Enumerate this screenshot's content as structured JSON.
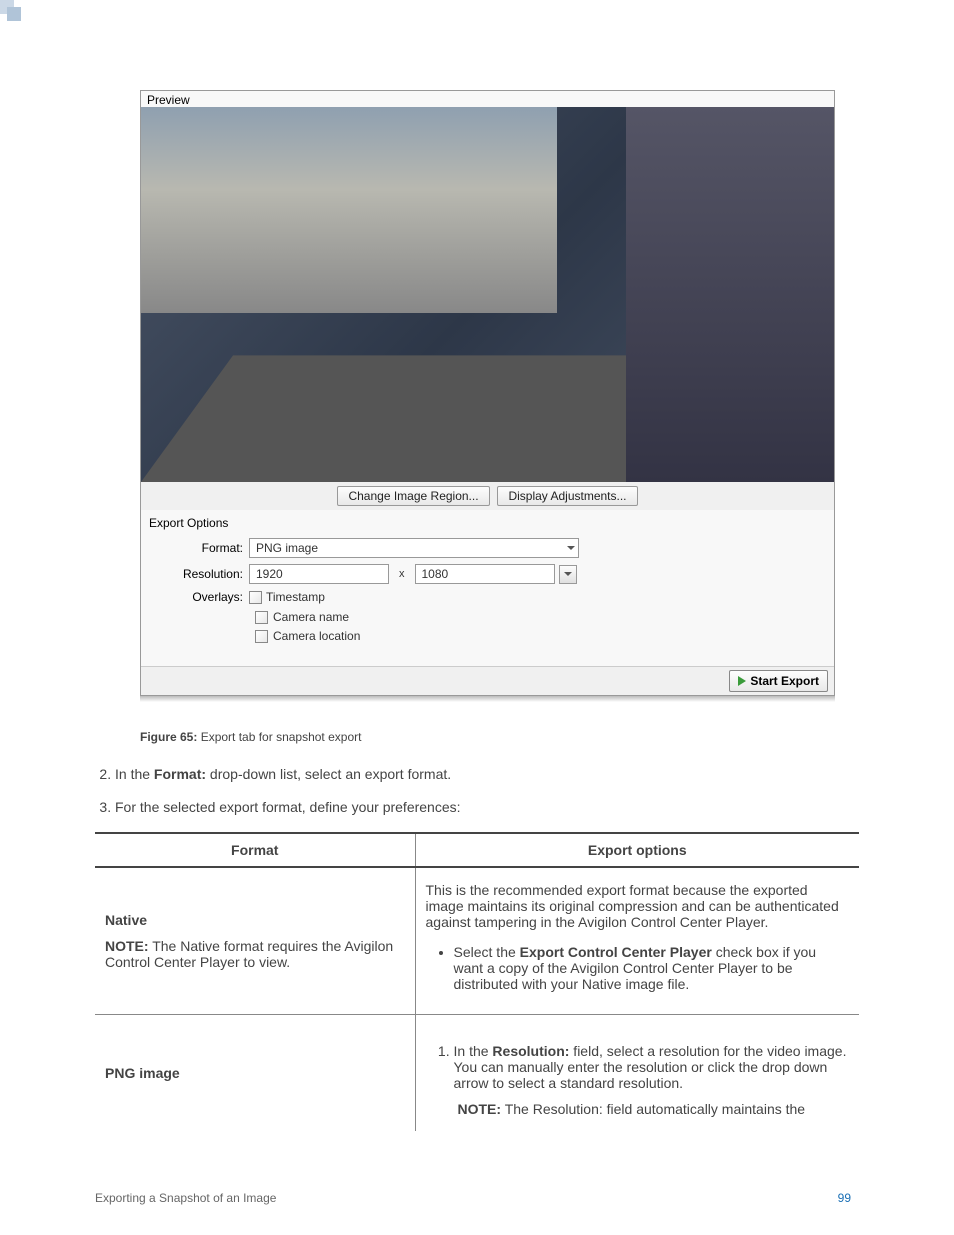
{
  "screenshot": {
    "preview_label": "Preview",
    "change_region_btn": "Change Image Region...",
    "display_adjustments_btn": "Display Adjustments...",
    "export_options_label": "Export Options",
    "format_label": "Format:",
    "format_value": "PNG image",
    "resolution_label": "Resolution:",
    "resolution_w": "1920",
    "resolution_x": "x",
    "resolution_h": "1080",
    "overlays_label": "Overlays:",
    "overlay_timestamp": "Timestamp",
    "overlay_camera_name": "Camera name",
    "overlay_camera_location": "Camera location",
    "start_export_btn": "Start Export"
  },
  "caption": {
    "prefix": "Figure 65:",
    "text": " Export tab for snapshot export"
  },
  "steps": {
    "s2_prefix": "In the ",
    "s2_bold": "Format:",
    "s2_suffix": " drop-down list, select an export format.",
    "s3": "For the selected export format, define your preferences:"
  },
  "table": {
    "th_format": "Format",
    "th_options": "Export options",
    "row1": {
      "format_title": "Native",
      "note_prefix": "NOTE:",
      "note_text": " The Native format requires the Avigilon Control Center Player to view.",
      "desc": "This is the recommended export format because the exported image maintains its original compression and can be authenticated against tampering in the Avigilon Control Center Player.",
      "bullet_prefix": "Select the ",
      "bullet_bold": "Export Control Center Player",
      "bullet_suffix": " check box if you want a copy of the Avigilon Control Center Player to be distributed with your Native image file."
    },
    "row2": {
      "format_title": "PNG image",
      "step1_prefix": "In the ",
      "step1_bold": "Resolution:",
      "step1_suffix": " field, select a resolution for the video image. You can manually enter the resolution or click the drop down arrow to select a standard resolution.",
      "note_prefix": "NOTE:",
      "note_text": " The Resolution: field automatically maintains the"
    }
  },
  "footer": {
    "left": "Exporting a Snapshot of an Image",
    "page": "99"
  }
}
